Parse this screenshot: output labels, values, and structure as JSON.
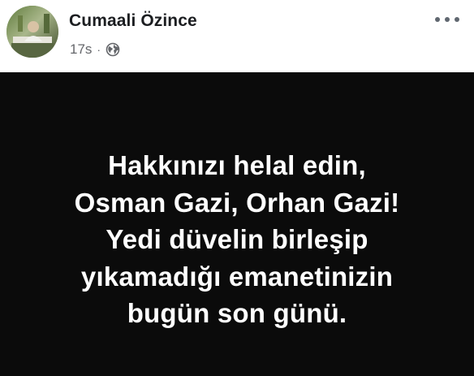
{
  "post": {
    "author": "Cumaali Özince",
    "timestamp": "17s",
    "separator": "·",
    "audience_icon": "globe-icon",
    "menu_icon": "more-options-icon",
    "avatar_icon": "profile-avatar",
    "message_lines": [
      "Hakkınızı helal edin,",
      "Osman Gazi, Orhan Gazi!",
      "Yedi düvelin birleşip",
      "yıkamadığı emanetinizin",
      "bugün son günü."
    ],
    "colors": {
      "background_card": "#ffffff",
      "content_background": "#0b0b0b",
      "message_text": "#ffffff",
      "author_text": "#1c1e21",
      "meta_text": "#65676b"
    }
  }
}
